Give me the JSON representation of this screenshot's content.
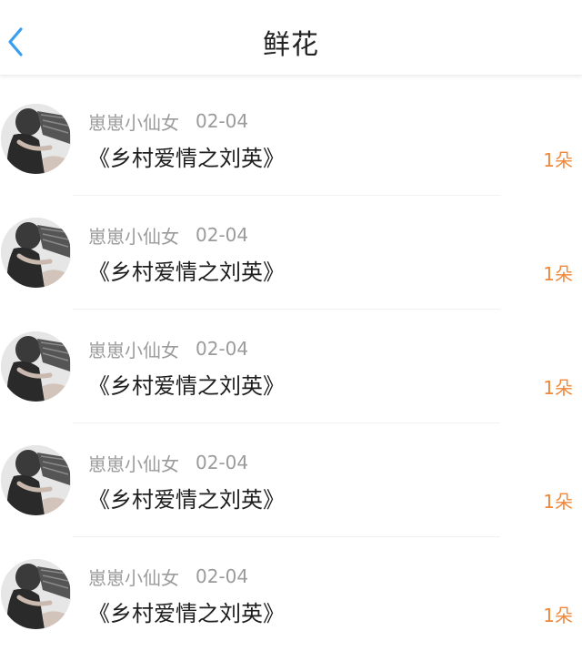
{
  "header": {
    "title": "鲜花",
    "back_icon": "chevron-left-icon",
    "accent": "#3a9ef0"
  },
  "list": {
    "items": [
      {
        "user": "崽崽小仙女",
        "date": "02-04",
        "book": "《乡村爱情之刘英》",
        "count": "1朵"
      },
      {
        "user": "崽崽小仙女",
        "date": "02-04",
        "book": "《乡村爱情之刘英》",
        "count": "1朵"
      },
      {
        "user": "崽崽小仙女",
        "date": "02-04",
        "book": "《乡村爱情之刘英》",
        "count": "1朵"
      },
      {
        "user": "崽崽小仙女",
        "date": "02-04",
        "book": "《乡村爱情之刘英》",
        "count": "1朵"
      },
      {
        "user": "崽崽小仙女",
        "date": "02-04",
        "book": "《乡村爱情之刘英》",
        "count": "1朵"
      }
    ]
  },
  "colors": {
    "count": "#f0883b",
    "meta": "#9b9b9b",
    "text": "#1e1e1e"
  }
}
